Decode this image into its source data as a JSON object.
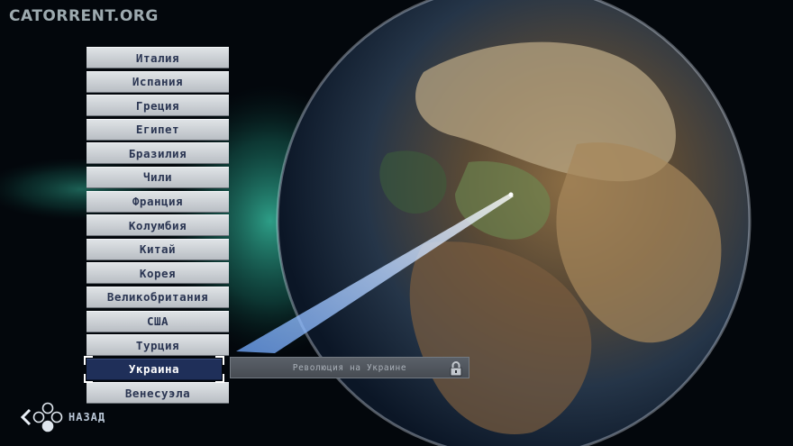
{
  "watermark": "CATORRENT.ORG",
  "countries": [
    {
      "label": "Италия"
    },
    {
      "label": "Испания"
    },
    {
      "label": "Греция"
    },
    {
      "label": "Египет"
    },
    {
      "label": "Бразилия"
    },
    {
      "label": "Чили"
    },
    {
      "label": "Франция"
    },
    {
      "label": "Колумбия"
    },
    {
      "label": "Китай"
    },
    {
      "label": "Корея"
    },
    {
      "label": "Великобритания"
    },
    {
      "label": "США"
    },
    {
      "label": "Турция"
    },
    {
      "label": "Украина",
      "selected": true
    },
    {
      "label": "Венесуэла"
    }
  ],
  "mission": {
    "label": "Революция на Украине",
    "locked": true,
    "icon": "lock-icon"
  },
  "nav": {
    "back_label": "НАЗАД",
    "icons": [
      "back-chevron-icon",
      "face-buttons-icon"
    ]
  },
  "colors": {
    "selected_bg": "#1f2f59",
    "list_bg": "#cfd3d7",
    "list_text": "#2a3552"
  }
}
